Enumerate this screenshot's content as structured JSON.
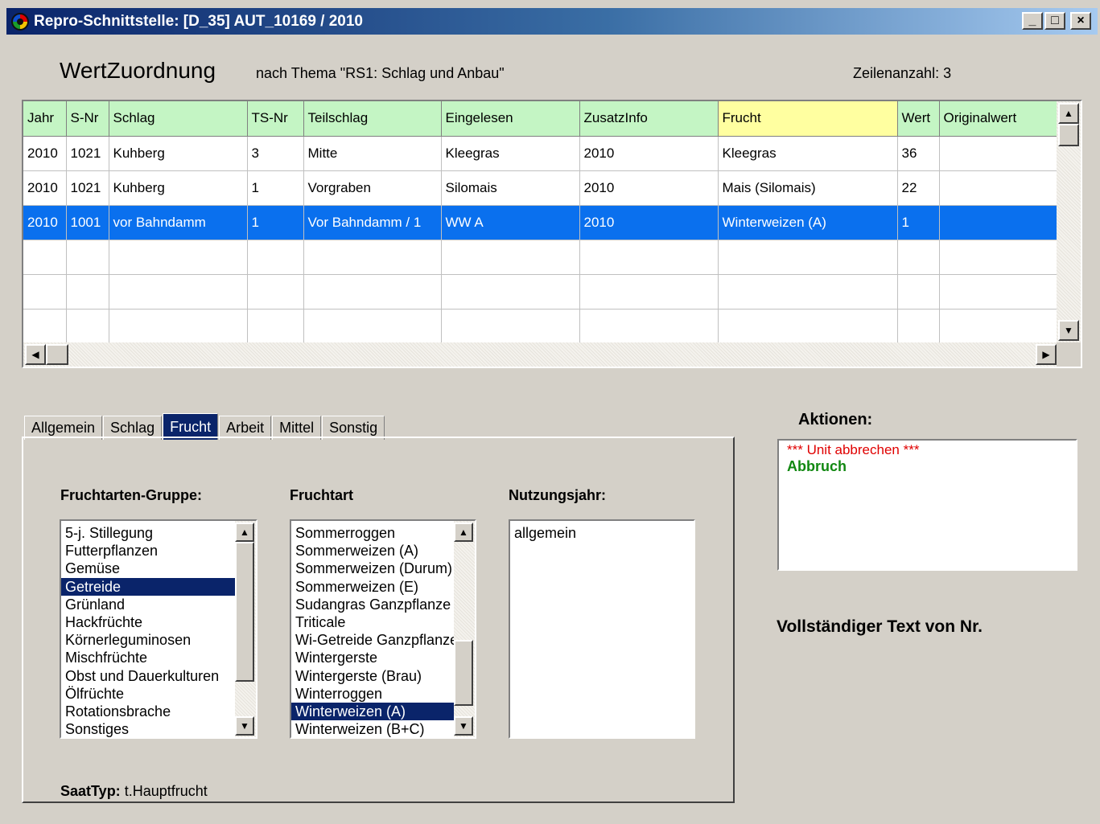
{
  "window": {
    "title": "Repro-Schnittstelle: [D_35] AUT_10169 / 2010",
    "buttons": {
      "minimize": "_",
      "maximize": "□",
      "close": "×"
    }
  },
  "header": {
    "title": "WertZuordnung",
    "subtitle": "nach Thema \"RS1: Schlag und Anbau\"",
    "rowcount_label": "Zeilenanzahl:",
    "rowcount_value": "3"
  },
  "grid": {
    "columns": [
      "Jahr",
      "S-Nr",
      "Schlag",
      "TS-Nr",
      "Teilschlag",
      "Eingelesen",
      "ZusatzInfo",
      "Frucht",
      "Wert",
      "Originalwert"
    ],
    "highlight_column": "Frucht",
    "rows": [
      [
        "2010",
        "1021",
        "Kuhberg",
        "3",
        "Mitte",
        "Kleegras",
        "2010",
        "Kleegras",
        "36",
        ""
      ],
      [
        "2010",
        "1021",
        "Kuhberg",
        "1",
        "Vorgraben",
        "Silomais",
        "2010",
        "Mais (Silomais)",
        "22",
        ""
      ],
      [
        "2010",
        "1001",
        "vor Bahndamm",
        "1",
        "Vor Bahndamm / 1",
        "WW A",
        "2010",
        "Winterweizen (A)",
        "1",
        ""
      ]
    ],
    "selected_row": 2
  },
  "tabs": [
    "Allgemein",
    "Schlag",
    "Frucht",
    "Arbeit",
    "Mittel",
    "Sonstig"
  ],
  "active_tab": "Frucht",
  "frucht_panel": {
    "group_label": "Fruchtarten-Gruppe:",
    "groups": [
      "5-j. Stillegung",
      "Futterpflanzen",
      "Gemüse",
      "Getreide",
      "Grünland",
      "Hackfrüchte",
      "Körnerleguminosen",
      "Mischfrüchte",
      "Obst und Dauerkulturen",
      "Ölfrüchte",
      "Rotationsbrache",
      "Sonstiges"
    ],
    "selected_group": "Getreide",
    "crop_label": "Fruchtart",
    "crops": [
      "Sommerroggen",
      "Sommerweizen (A)",
      "Sommerweizen (Durum)",
      "Sommerweizen (E)",
      "Sudangras Ganzpflanze",
      "Triticale",
      "Wi-Getreide Ganzpflanze",
      "Wintergerste",
      "Wintergerste (Brau)",
      "Winterroggen",
      "Winterweizen (A)",
      "Winterweizen (B+C)"
    ],
    "selected_crop": "Winterweizen (A)",
    "year_label": "Nutzungsjahr:",
    "years": [
      "allgemein"
    ],
    "saat_label": "SaatTyp:",
    "saat_value": "t.Hauptfrucht"
  },
  "actions": {
    "title": "Aktionen:",
    "cancel_text": "*** Unit abbrechen ***",
    "abort_text": "Abbruch"
  },
  "fulltext_label": "Vollständiger Text von Nr."
}
